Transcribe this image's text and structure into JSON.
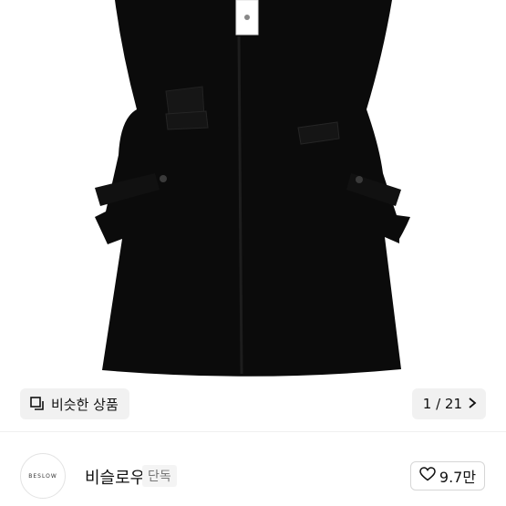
{
  "product_image": {
    "similar_button_label": "비슷한 상품",
    "similar_icon": "stack-copy-icon",
    "page_counter": "1 / 21",
    "next_icon": "chevron-right-icon"
  },
  "brand": {
    "logo_text": "BESLOW",
    "name": "비슬로우",
    "badge": "단독"
  },
  "like": {
    "icon": "heart-outline-icon",
    "count": "9.7만"
  }
}
